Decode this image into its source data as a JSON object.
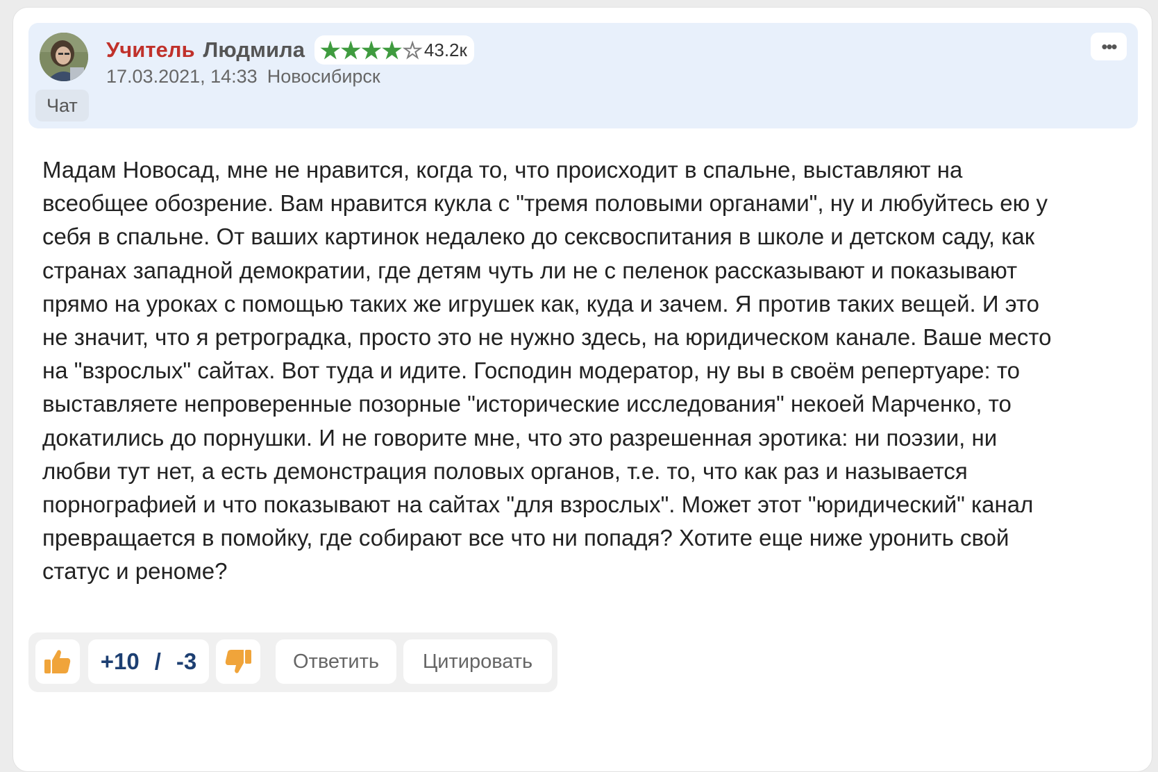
{
  "comment": {
    "author": {
      "rank": "Учитель",
      "name": "Людмила",
      "stars_filled": 4,
      "stars_total": 5,
      "rating_count": "43.2к"
    },
    "meta": {
      "datetime": "17.03.2021, 14:33",
      "city": "Новосибирск"
    },
    "chat_label": "Чат",
    "more_label": "•••",
    "text": "Мадам Новосад, мне не нравится, когда то, что происходит в спальне, выставляют на всеобщее обозрение. Вам нравится кукла с \"тремя половыми органами\", ну и любуйтесь ею у себя в спальне. От ваших картинок недалеко до сексвоспитания в школе и детском саду, как странах западной демократии, где детям чуть ли не с пеленок рассказывают и показывают прямо на уроках с помощью таких же игрушек как, куда и зачем. Я против таких вещей. И это не значит, что я ретроградка, просто это не нужно здесь, на юридическом канале. Ваше место на \"взрослых\" сайтах. Вот туда и идите. Господин модератор, ну вы в своём репертуаре: то выставляете непроверенные позорные \"исторические исследования\" некоей Марченко, то докатились до порнушки. И не говорите мне, что это разрешенная эротика: ни поэзии, ни любви тут нет, а есть демонстрация половых органов, т.е. то, что как раз и называется порнографией и что показывают на сайтах \"для взрослых\". Может этот \"юридический\" канал превращается в помойку, где собирают все что ни попадя? Хотите еще ниже уронить свой статус и реноме?",
    "votes": {
      "plus": "+10",
      "separator": "/",
      "minus": "-3"
    },
    "actions": {
      "reply": "Ответить",
      "quote": "Цитировать"
    },
    "colors": {
      "rank": "#c0312b",
      "star": "#3f9b3f",
      "thumb": "#f0a43a",
      "score": "#1d3f72",
      "header_bg": "#e8f0fb"
    }
  }
}
